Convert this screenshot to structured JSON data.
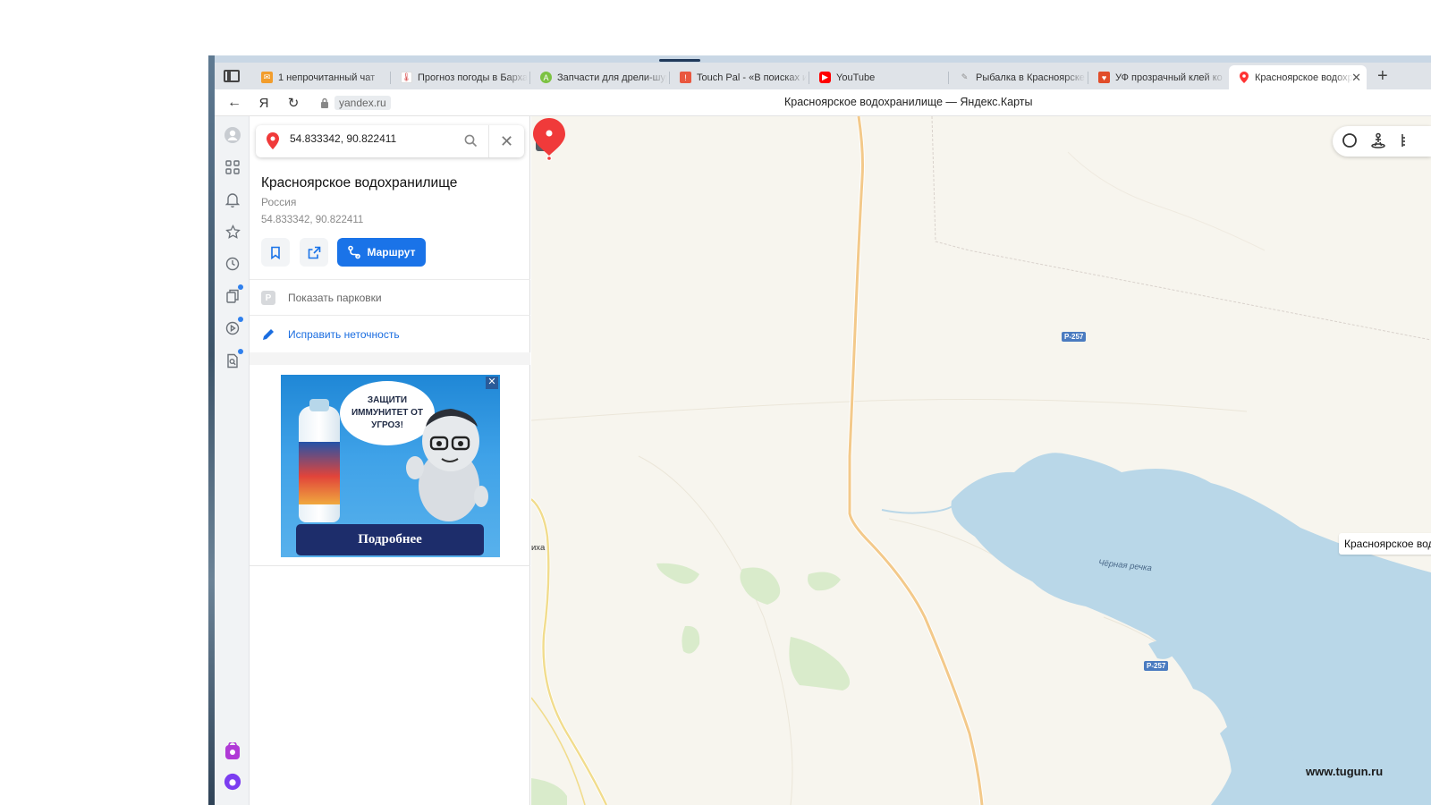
{
  "browser": {
    "tabs": [
      {
        "label": "1 непрочитанный чат",
        "icon": "mail-icon",
        "color": "#f29d2c"
      },
      {
        "label": "Прогноз погоды в Барха",
        "icon": "thermometer-icon",
        "color": "#d64545"
      },
      {
        "label": "Запчасти для дрели-шур",
        "icon": "parts-site-icon",
        "color": "#7cc242"
      },
      {
        "label": "Touch Pal - «В поисках и",
        "icon": "touchpal-icon",
        "color": "#e9573f"
      },
      {
        "label": "YouTube",
        "icon": "youtube-icon",
        "color": "#ff0000"
      },
      {
        "label": "Рыбалка в Красноярске",
        "icon": "pencil-site-icon",
        "color": "#8e8e8e"
      },
      {
        "label": "УФ прозрачный клей ко",
        "icon": "shop-icon",
        "color": "#e14d2a"
      },
      {
        "label": "Красноярское водохр",
        "icon": "maps-pin-icon",
        "color": "#ff3333",
        "active": true
      }
    ],
    "address": {
      "logo": "Я",
      "url": "yandex.ru",
      "page_title": "Красноярское водохранилище — Яндекс.Карты"
    }
  },
  "panel": {
    "search": {
      "value": "54.833342, 90.822411"
    },
    "place": {
      "title": "Красноярское водохранилище",
      "country": "Россия",
      "coords": "54.833342, 90.822411"
    },
    "route_label": "Маршрут",
    "parking_label": "Показать парковки",
    "parking_icon_letter": "P",
    "fix_label": "Исправить неточность",
    "ad": {
      "bubble_text": "ЗАЩИТИ ИММУНИТЕТ ОТ УГРОЗ!",
      "cta": "Подробнее"
    }
  },
  "map": {
    "road_shields": [
      "Р-257",
      "Р-257"
    ],
    "river_label": "Чёрная речка",
    "partial_label": "иха",
    "marker_label": "Красноярское водохрани...",
    "colors": {
      "water": "#b9d7e8",
      "land": "#f7f5ee",
      "road": "#f3c98a",
      "forest": "#d9ebcb",
      "marker": "#f03a3a"
    }
  },
  "watermark": "www.tugun.ru"
}
